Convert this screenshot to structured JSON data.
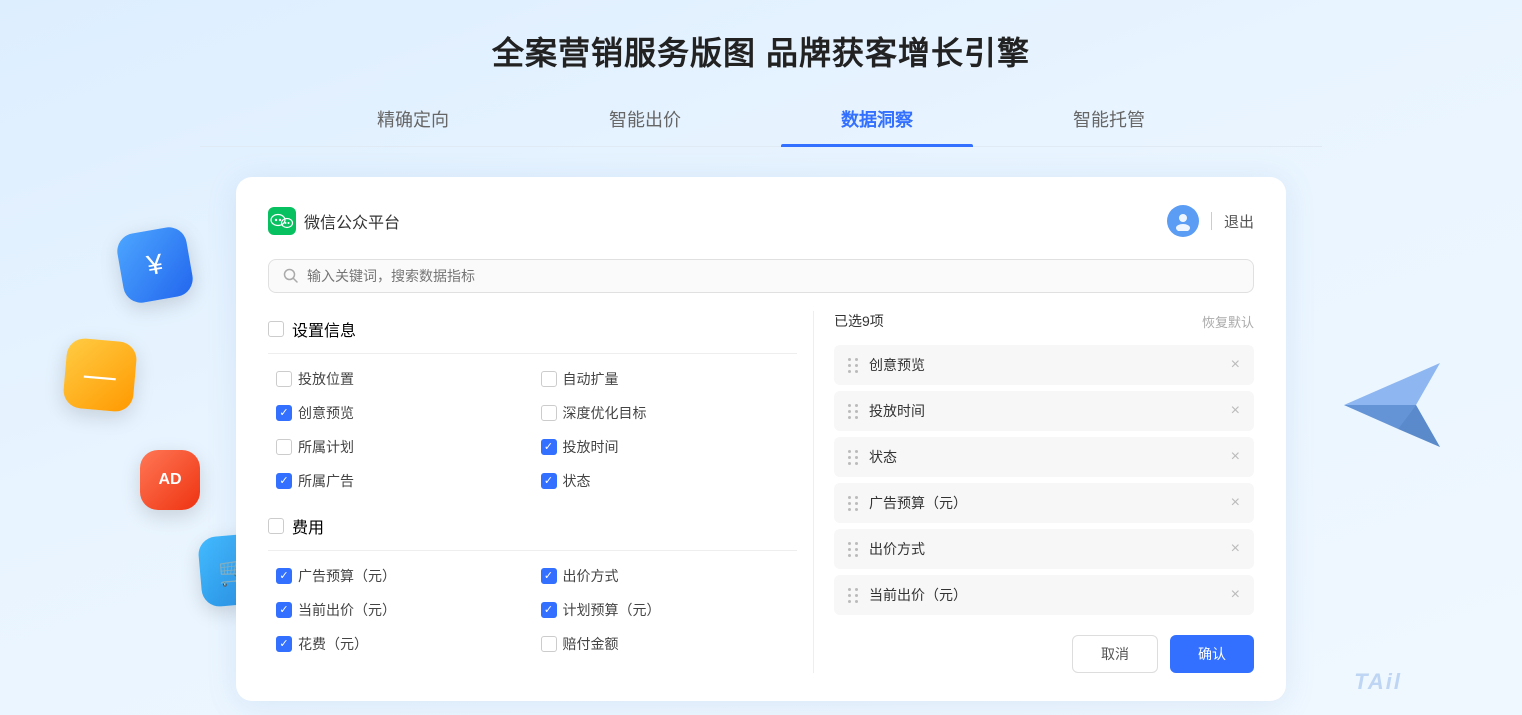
{
  "page": {
    "title": "全案营销服务版图 品牌获客增长引擎",
    "tabs": [
      {
        "id": "targeting",
        "label": "精确定向",
        "active": false
      },
      {
        "id": "bidding",
        "label": "智能出价",
        "active": false
      },
      {
        "id": "insights",
        "label": "数据洞察",
        "active": true
      },
      {
        "id": "managed",
        "label": "智能托管",
        "active": false
      }
    ]
  },
  "dialog": {
    "platform": "微信公众平台",
    "search_placeholder": "输入关键词，搜索数据指标",
    "logout_label": "退出",
    "selected_count_label": "已选9项",
    "restore_label": "恢复默认",
    "sections": [
      {
        "id": "settings",
        "label": "设置信息",
        "checked": false,
        "items": [
          {
            "id": "placement",
            "label": "投放位置",
            "checked": false,
            "col": 0
          },
          {
            "id": "auto-expand",
            "label": "自动扩量",
            "checked": false,
            "col": 1
          },
          {
            "id": "creative-preview",
            "label": "创意预览",
            "checked": true,
            "col": 0
          },
          {
            "id": "deep-optimize",
            "label": "深度优化目标",
            "checked": false,
            "col": 1
          },
          {
            "id": "plan",
            "label": "所属计划",
            "checked": false,
            "col": 0
          },
          {
            "id": "delivery-time",
            "label": "投放时间",
            "checked": true,
            "col": 1
          },
          {
            "id": "ad-belong",
            "label": "所属广告",
            "checked": true,
            "col": 0
          },
          {
            "id": "status",
            "label": "状态",
            "checked": true,
            "col": 1
          }
        ]
      },
      {
        "id": "cost",
        "label": "费用",
        "checked": false,
        "items": [
          {
            "id": "ad-budget",
            "label": "广告预算（元）",
            "checked": true,
            "col": 0
          },
          {
            "id": "bid-method",
            "label": "出价方式",
            "checked": true,
            "col": 1
          },
          {
            "id": "current-bid",
            "label": "当前出价（元）",
            "checked": true,
            "col": 0
          },
          {
            "id": "plan-budget",
            "label": "计划预算（元）",
            "checked": true,
            "col": 1
          },
          {
            "id": "spend",
            "label": "花费（元）",
            "checked": true,
            "col": 0
          },
          {
            "id": "compensation",
            "label": "赔付金额",
            "checked": false,
            "col": 1
          }
        ]
      }
    ],
    "selected_items": [
      {
        "id": "creative-preview",
        "label": "创意预览"
      },
      {
        "id": "delivery-time",
        "label": "投放时间"
      },
      {
        "id": "status",
        "label": "状态"
      },
      {
        "id": "ad-budget",
        "label": "广告预算（元）"
      },
      {
        "id": "bid-method",
        "label": "出价方式"
      },
      {
        "id": "current-bid",
        "label": "当前出价（元）"
      }
    ],
    "cancel_label": "取消",
    "confirm_label": "确认"
  },
  "watermark": "TAil"
}
